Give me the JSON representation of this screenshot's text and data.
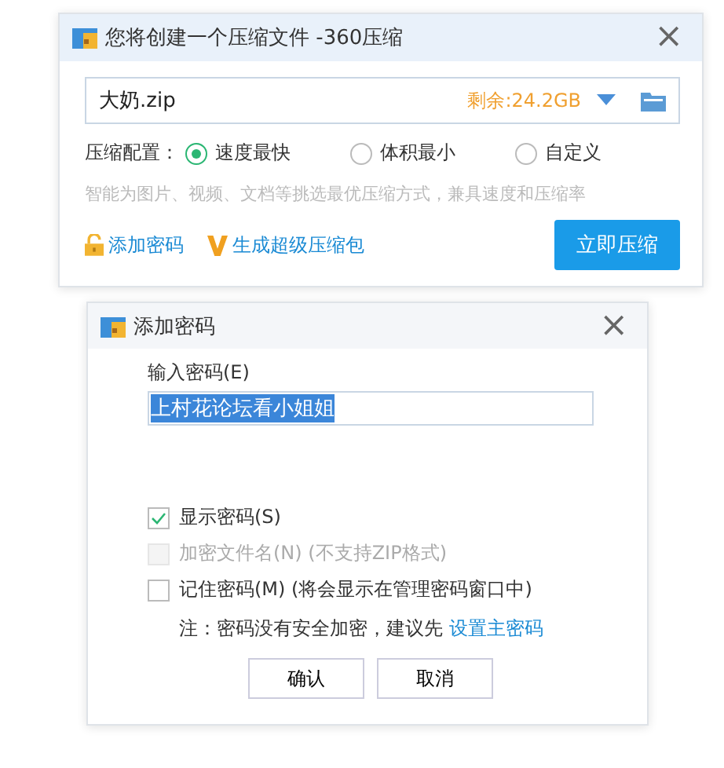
{
  "main_dialog": {
    "title": "您将创建一个压缩文件 -360压缩",
    "close": "×",
    "file_name": "大奶.zip",
    "free_space": "剩余:24.2GB",
    "config_label": "压缩配置：",
    "options": [
      {
        "label": "速度最快",
        "selected": true
      },
      {
        "label": "体积最小",
        "selected": false
      },
      {
        "label": "自定义",
        "selected": false
      }
    ],
    "hint": "智能为图片、视频、文档等挑选最优压缩方式，兼具速度和压缩率",
    "add_password": "添加密码",
    "super_package": "生成超级压缩包",
    "compress_button": "立即压缩"
  },
  "password_dialog": {
    "title": "添加密码",
    "close": "×",
    "input_label": "输入密码(E)",
    "password": "上村花论坛看小姐姐",
    "checkboxes": [
      {
        "label": "显示密码(S)",
        "checked": true,
        "disabled": false
      },
      {
        "label": "加密文件名(N) (不支持ZIP格式)",
        "checked": false,
        "disabled": true
      },
      {
        "label": "记住密码(M) (将会显示在管理密码窗口中)",
        "checked": false,
        "disabled": false
      }
    ],
    "note": "注：密码没有安全加密，建议先",
    "note_link": "设置主密码",
    "buttons": [
      "确认",
      "取消"
    ]
  }
}
